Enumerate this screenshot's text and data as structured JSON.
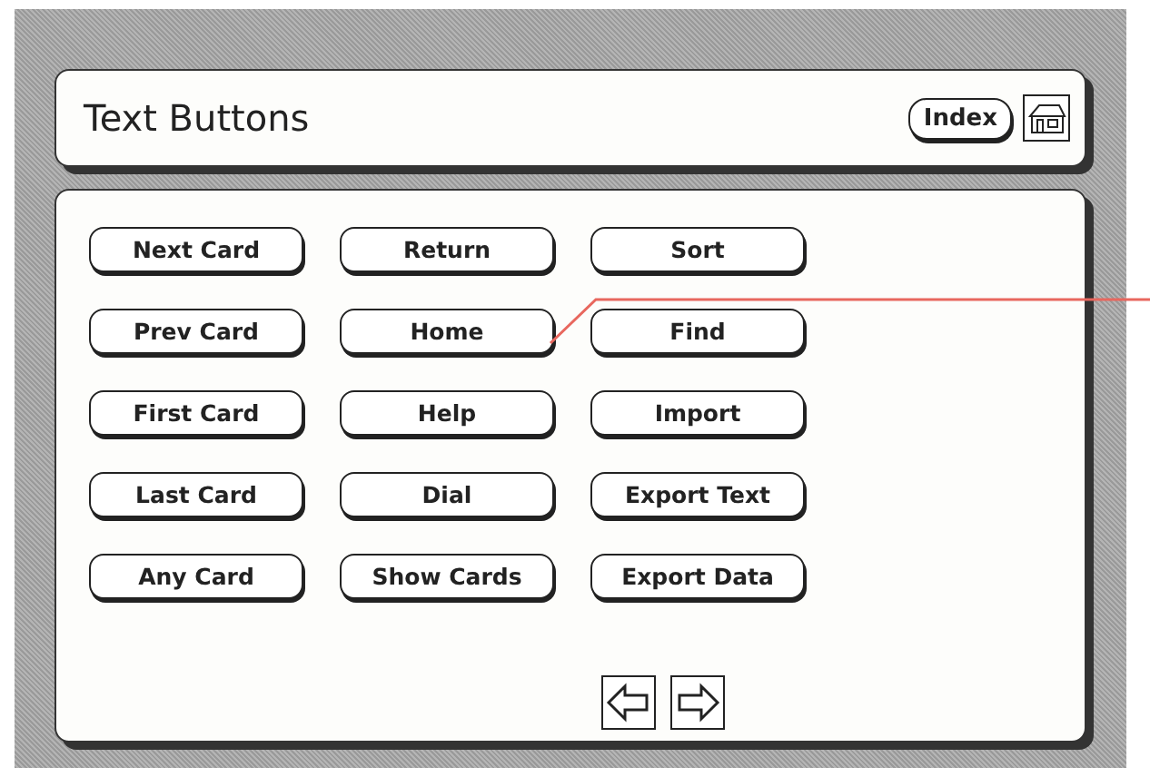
{
  "header": {
    "title": "Text Buttons",
    "index_button": "Index"
  },
  "button_rows": [
    [
      "Next Card",
      "Return",
      "Sort"
    ],
    [
      "Prev Card",
      "Home",
      "Find"
    ],
    [
      "First Card",
      "Help",
      "Import"
    ],
    [
      "Last Card",
      "Dial",
      "Export Text"
    ],
    [
      "Any Card",
      "Show Cards",
      "Export Data"
    ]
  ]
}
